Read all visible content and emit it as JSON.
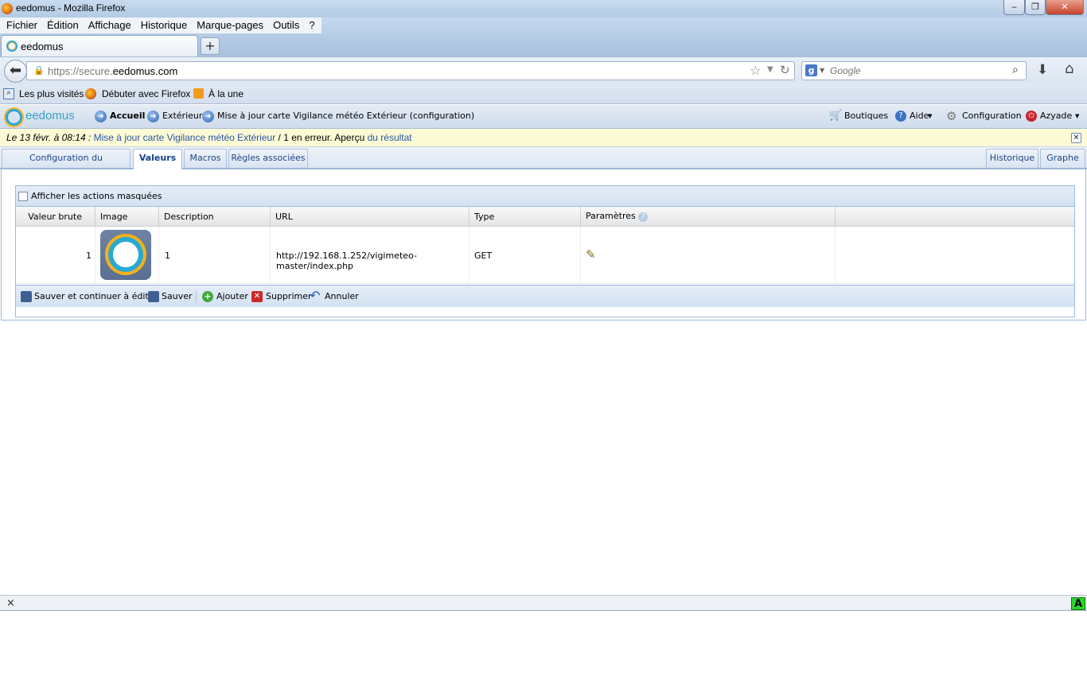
{
  "window": {
    "title": "eedomus - Mozilla Firefox",
    "minimize": "‒",
    "maximize": "❐",
    "close": "✕"
  },
  "menu": [
    "Fichier",
    "Édition",
    "Affichage",
    "Historique",
    "Marque-pages",
    "Outils",
    "?"
  ],
  "tab": {
    "title": "eedomus",
    "new_tab": "+"
  },
  "address": {
    "prefix": "https://secure.",
    "domain": "eedomus.com"
  },
  "search": {
    "placeholder": "Google"
  },
  "bookmarks": [
    "Les plus visités",
    "Débuter avec Firefox",
    "À la une"
  ],
  "app": {
    "logo": "eedomus",
    "breadcrumb": [
      "Accueil",
      "Extérieur",
      "Mise à jour carte Vigilance météo Extérieur (configuration)"
    ],
    "right_nav": {
      "shops": "Boutiques",
      "help": "Aide",
      "config": "Configuration",
      "user": "Azyade"
    }
  },
  "alert": {
    "date": "Le 13 févr. à 08:14 :",
    "link": "Mise à jour carte Vigilance météo Extérieur",
    "mid": " / 1 en erreur. Aperçu ",
    "result": "du résultat"
  },
  "panel_tabs": {
    "left": [
      "Configuration du périphérique",
      "Valeurs",
      "Macros",
      "Règles associées"
    ],
    "right": [
      "Historique",
      "Graphe"
    ]
  },
  "grid": {
    "show_hidden": "Afficher les actions masquées",
    "columns": [
      "Valeur brute",
      "Image",
      "Description",
      "URL",
      "Type",
      "Paramètres"
    ],
    "rows": [
      {
        "raw": "1",
        "description": "1",
        "url": "http://192.168.1.252/vigimeteo-master/index.php",
        "type": "GET"
      }
    ],
    "toolbar": {
      "save_continue": "Sauver et continuer à éditer",
      "save": "Sauver",
      "add": "Ajouter",
      "delete": "Supprimer",
      "cancel": "Annuler"
    }
  },
  "bottombar": {
    "close": "×",
    "addon": "A"
  }
}
